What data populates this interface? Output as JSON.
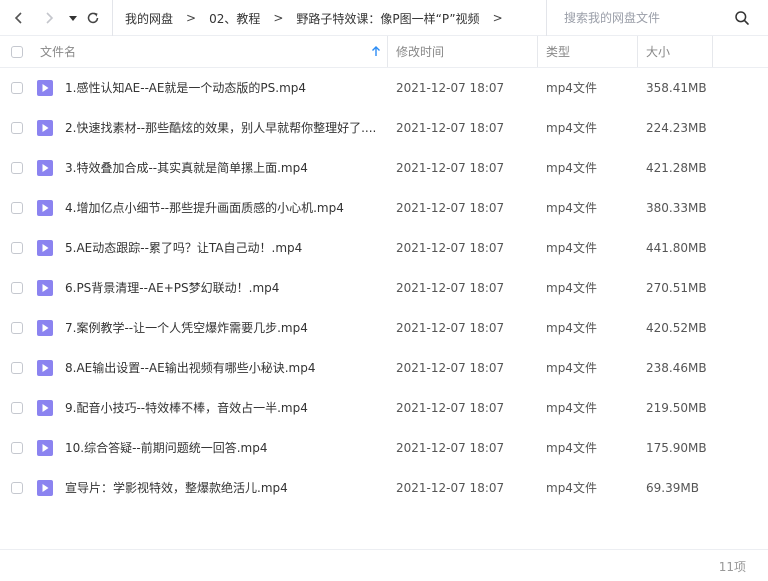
{
  "nav": {
    "back_icon": "chevron-left-icon",
    "forward_icon": "chevron-right-icon",
    "history_icon": "caret-down-icon",
    "refresh_icon": "refresh-icon"
  },
  "breadcrumb": {
    "items": [
      "我的网盘",
      "02、教程",
      "野路子特效课：像P图一样“P”视频"
    ],
    "separator": ">"
  },
  "search": {
    "placeholder": "搜索我的网盘文件",
    "icon": "search-icon"
  },
  "header": {
    "name": "文件名",
    "modified": "修改时间",
    "type": "类型",
    "size": "大小",
    "sort_icon": "arrow-up-icon"
  },
  "files": [
    {
      "name": "1.感性认知AE--AE就是一个动态版的PS.mp4",
      "date": "2021-12-07 18:07",
      "type": "mp4文件",
      "size": "358.41MB"
    },
    {
      "name": "2.快速找素材--那些酷炫的效果，别人早就帮你整理好了....",
      "date": "2021-12-07 18:07",
      "type": "mp4文件",
      "size": "224.23MB"
    },
    {
      "name": "3.特效叠加合成--其实真就是简单摞上面.mp4",
      "date": "2021-12-07 18:07",
      "type": "mp4文件",
      "size": "421.28MB"
    },
    {
      "name": "4.增加亿点小细节--那些提升画面质感的小心机.mp4",
      "date": "2021-12-07 18:07",
      "type": "mp4文件",
      "size": "380.33MB"
    },
    {
      "name": "5.AE动态跟踪--累了吗？让TA自己动！.mp4",
      "date": "2021-12-07 18:07",
      "type": "mp4文件",
      "size": "441.80MB"
    },
    {
      "name": "6.PS背景清理--AE+PS梦幻联动！.mp4",
      "date": "2021-12-07 18:07",
      "type": "mp4文件",
      "size": "270.51MB"
    },
    {
      "name": "7.案例教学--让一个人凭空爆炸需要几步.mp4",
      "date": "2021-12-07 18:07",
      "type": "mp4文件",
      "size": "420.52MB"
    },
    {
      "name": "8.AE输出设置--AE输出视频有哪些小秘诀.mp4",
      "date": "2021-12-07 18:07",
      "type": "mp4文件",
      "size": "238.46MB"
    },
    {
      "name": "9.配音小技巧--特效棒不棒，音效占一半.mp4",
      "date": "2021-12-07 18:07",
      "type": "mp4文件",
      "size": "219.50MB"
    },
    {
      "name": "10.综合答疑--前期问题统一回答.mp4",
      "date": "2021-12-07 18:07",
      "type": "mp4文件",
      "size": "175.90MB"
    },
    {
      "name": "宣导片：学影视特效，整爆款绝活儿.mp4",
      "date": "2021-12-07 18:07",
      "type": "mp4文件",
      "size": "69.39MB"
    }
  ],
  "footer": {
    "count": "11项"
  },
  "colors": {
    "file_icon": "#8b83f0",
    "sort_arrow": "#2b8cf5"
  }
}
